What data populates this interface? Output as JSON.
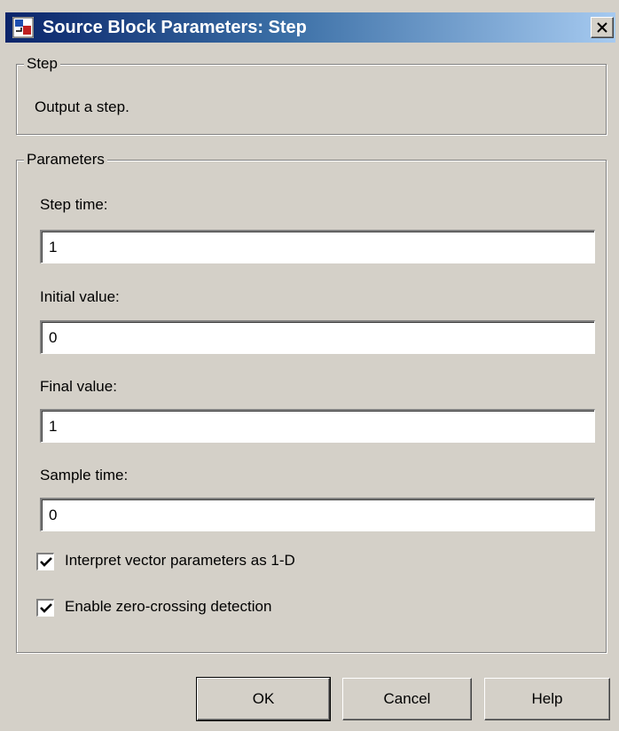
{
  "window": {
    "title": "Source Block Parameters: Step",
    "close_symbol": "✕"
  },
  "description_group": {
    "legend": "Step",
    "text": "Output a step."
  },
  "parameters_group": {
    "legend": "Parameters",
    "fields": [
      {
        "label": "Step time:",
        "value": "1"
      },
      {
        "label": "Initial value:",
        "value": "0"
      },
      {
        "label": "Final value:",
        "value": "1"
      },
      {
        "label": "Sample time:",
        "value": "0"
      }
    ],
    "checkboxes": [
      {
        "label": "Interpret vector parameters as 1-D",
        "checked": true
      },
      {
        "label": "Enable zero-crossing detection",
        "checked": true
      }
    ]
  },
  "buttons": {
    "ok": "OK",
    "cancel": "Cancel",
    "help": "Help"
  },
  "icons": {
    "app": "simulink-block-icon",
    "close": "close-icon",
    "check": "checkmark-icon"
  },
  "colors": {
    "titlebar_start": "#0a246a",
    "titlebar_end": "#a6caf0",
    "dialog_bg": "#d4d0c8"
  }
}
